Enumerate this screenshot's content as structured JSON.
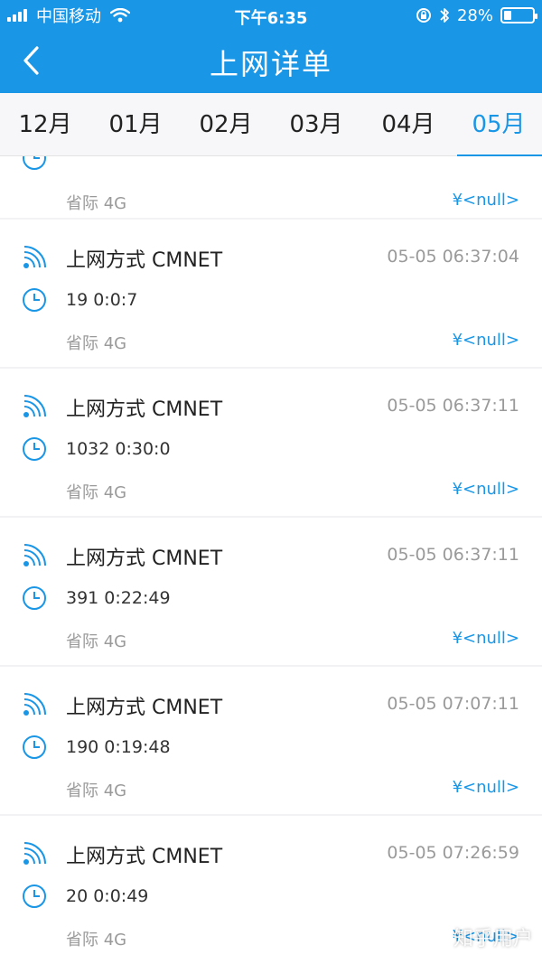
{
  "status_bar": {
    "carrier": "中国移动",
    "time": "下午6:35",
    "battery": "28%",
    "battery_level": 0.28
  },
  "header": {
    "title": "上网详单"
  },
  "tabs": [
    {
      "label": "12月",
      "active": false
    },
    {
      "label": "01月",
      "active": false
    },
    {
      "label": "02月",
      "active": false
    },
    {
      "label": "03月",
      "active": false
    },
    {
      "label": "04月",
      "active": false
    },
    {
      "label": "05月",
      "active": true
    }
  ],
  "records": [
    {
      "network": "省际 4G",
      "cost": "¥<null>"
    },
    {
      "title": "上网方式 CMNET",
      "time": "05-05 06:37:04",
      "duration": "19 0:0:7",
      "network": "省际 4G",
      "cost": "¥<null>"
    },
    {
      "title": "上网方式 CMNET",
      "time": "05-05 06:37:11",
      "duration": "1032 0:30:0",
      "network": "省际 4G",
      "cost": "¥<null>"
    },
    {
      "title": "上网方式 CMNET",
      "time": "05-05 06:37:11",
      "duration": "391 0:22:49",
      "network": "省际 4G",
      "cost": "¥<null>"
    },
    {
      "title": "上网方式 CMNET",
      "time": "05-05 07:07:11",
      "duration": "190 0:19:48",
      "network": "省际 4G",
      "cost": "¥<null>"
    },
    {
      "title": "上网方式 CMNET",
      "time": "05-05 07:26:59",
      "duration": "20 0:0:49",
      "network": "省际 4G",
      "cost": "¥<null>"
    }
  ],
  "watermark": "知乎用户",
  "colors": {
    "accent": "#1a96e6",
    "background": "#f2f2f4"
  },
  "icons": [
    "signal-icon",
    "wifi-icon",
    "lock-rotation-icon",
    "bluetooth-icon",
    "battery-icon",
    "back-chevron-icon",
    "wifi-signal-icon",
    "clock-icon"
  ]
}
